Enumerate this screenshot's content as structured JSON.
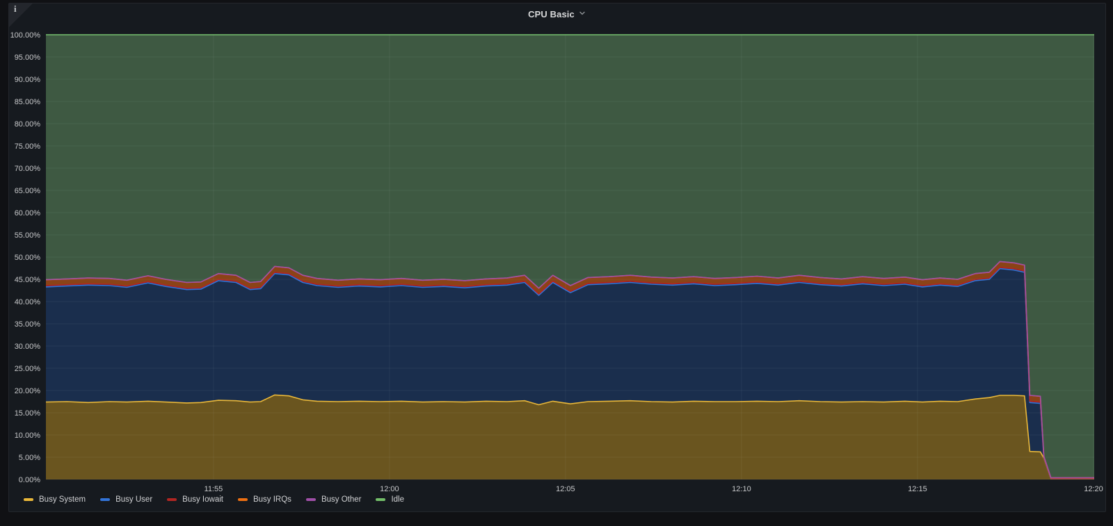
{
  "header": {
    "title": "CPU Basic"
  },
  "corner_icon": {
    "glyph": "i",
    "name": "panel-info"
  },
  "legend": {
    "items": [
      {
        "label": "Busy System",
        "color": "#EAB839"
      },
      {
        "label": "Busy User",
        "color": "#3274D9"
      },
      {
        "label": "Busy Iowait",
        "color": "#B22622"
      },
      {
        "label": "Busy IRQs",
        "color": "#EE7012"
      },
      {
        "label": "Busy Other",
        "color": "#A04FA8"
      },
      {
        "label": "Idle",
        "color": "#73BF69"
      }
    ]
  },
  "chart_data": {
    "type": "area",
    "stacked": true,
    "title": "CPU Basic",
    "x_domain": [
      0,
      29.78
    ],
    "x_axis": {
      "tick_labels": [
        "11:55",
        "12:00",
        "12:05",
        "12:10",
        "12:15",
        "12:20"
      ],
      "tick_positions": [
        4.76,
        9.76,
        14.76,
        19.76,
        24.76,
        29.76
      ]
    },
    "y_axis": {
      "min": 0,
      "max": 100,
      "tick_step": 5,
      "unit": "%",
      "tick_labels": [
        "0.00%",
        "5.00%",
        "10.00%",
        "15.00%",
        "20.00%",
        "25.00%",
        "30.00%",
        "35.00%",
        "40.00%",
        "45.00%",
        "50.00%",
        "55.00%",
        "60.00%",
        "65.00%",
        "70.00%",
        "75.00%",
        "80.00%",
        "85.00%",
        "90.00%",
        "95.00%",
        "100.00%"
      ]
    },
    "grid": true,
    "legend_position": "bottom-left",
    "t_minutes": [
      0,
      0.6,
      1.2,
      1.8,
      2.3,
      2.9,
      3.4,
      4.0,
      4.4,
      4.9,
      5.4,
      5.8,
      6.1,
      6.5,
      6.9,
      7.3,
      7.7,
      8.3,
      8.9,
      9.5,
      10.1,
      10.7,
      11.3,
      11.9,
      12.5,
      13.1,
      13.6,
      14.0,
      14.4,
      14.9,
      15.4,
      16.0,
      16.6,
      17.2,
      17.8,
      18.4,
      19.0,
      19.6,
      20.2,
      20.8,
      21.4,
      22.0,
      22.6,
      23.2,
      23.8,
      24.4,
      24.9,
      25.4,
      25.9,
      26.4,
      26.8,
      27.1,
      27.5,
      27.8,
      27.95,
      28.25,
      28.35,
      28.55,
      29.0,
      29.78
    ],
    "series": [
      {
        "name": "Busy System",
        "color": "#EAB839",
        "fill": "#6a551f",
        "values": [
          17.4,
          17.5,
          17.3,
          17.5,
          17.4,
          17.6,
          17.4,
          17.2,
          17.3,
          17.8,
          17.7,
          17.4,
          17.5,
          19.0,
          18.8,
          17.9,
          17.6,
          17.5,
          17.6,
          17.5,
          17.6,
          17.4,
          17.5,
          17.4,
          17.6,
          17.5,
          17.7,
          16.8,
          17.6,
          17.0,
          17.5,
          17.6,
          17.7,
          17.5,
          17.4,
          17.6,
          17.5,
          17.5,
          17.6,
          17.5,
          17.7,
          17.5,
          17.4,
          17.5,
          17.4,
          17.6,
          17.4,
          17.6,
          17.5,
          18.1,
          18.4,
          18.9,
          18.9,
          18.8,
          6.3,
          6.2,
          4.8,
          0.15,
          0.15,
          0.15
        ]
      },
      {
        "name": "Busy User",
        "color": "#3274D9",
        "fill": "#1a2e4d",
        "values": [
          25.9,
          26.0,
          26.4,
          26.1,
          25.8,
          26.6,
          26.0,
          25.5,
          25.5,
          26.9,
          26.6,
          25.3,
          25.4,
          27.3,
          27.2,
          26.4,
          26.0,
          25.7,
          25.9,
          25.8,
          26.0,
          25.8,
          25.9,
          25.7,
          25.9,
          26.2,
          26.6,
          24.6,
          26.7,
          25.0,
          26.3,
          26.4,
          26.6,
          26.4,
          26.3,
          26.4,
          26.1,
          26.3,
          26.5,
          26.2,
          26.6,
          26.3,
          26.1,
          26.5,
          26.2,
          26.3,
          25.9,
          26.1,
          25.9,
          26.6,
          26.6,
          28.5,
          28.2,
          27.8,
          11.0,
          10.9,
          0.1,
          0.05,
          0.05,
          0.05
        ]
      },
      {
        "name": "Busy Iowait",
        "color": "#B22622",
        "fill": "#4a1d1f",
        "values": [
          0.3,
          0.3,
          0.3,
          0.3,
          0.3,
          0.3,
          0.3,
          0.3,
          0.3,
          0.3,
          0.3,
          0.3,
          0.3,
          0.3,
          0.3,
          0.3,
          0.3,
          0.3,
          0.3,
          0.3,
          0.3,
          0.3,
          0.3,
          0.3,
          0.3,
          0.3,
          0.3,
          0.3,
          0.3,
          0.3,
          0.3,
          0.3,
          0.3,
          0.3,
          0.3,
          0.3,
          0.3,
          0.3,
          0.3,
          0.3,
          0.3,
          0.3,
          0.3,
          0.3,
          0.3,
          0.3,
          0.3,
          0.3,
          0.3,
          0.3,
          0.3,
          0.3,
          0.3,
          0.3,
          0.3,
          0.3,
          0.05,
          0.02,
          0.02,
          0.02
        ]
      },
      {
        "name": "Busy IRQs",
        "color": "#D9661B",
        "fill": "#8a4317",
        "values": [
          1.3,
          1.3,
          1.3,
          1.3,
          1.3,
          1.3,
          1.3,
          1.3,
          1.3,
          1.3,
          1.3,
          1.3,
          1.3,
          1.3,
          1.3,
          1.3,
          1.3,
          1.3,
          1.3,
          1.3,
          1.3,
          1.3,
          1.3,
          1.3,
          1.3,
          1.3,
          1.3,
          1.3,
          1.3,
          1.3,
          1.3,
          1.3,
          1.3,
          1.3,
          1.3,
          1.3,
          1.3,
          1.3,
          1.3,
          1.3,
          1.3,
          1.3,
          1.3,
          1.3,
          1.3,
          1.3,
          1.3,
          1.3,
          1.3,
          1.3,
          1.3,
          1.3,
          1.3,
          1.3,
          1.3,
          1.3,
          0.25,
          0.15,
          0.15,
          0.15
        ]
      },
      {
        "name": "Busy Other",
        "color": "#A04FA8",
        "fill": "#3d2542",
        "values": [
          0,
          0,
          0,
          0,
          0,
          0,
          0,
          0,
          0,
          0,
          0,
          0,
          0,
          0,
          0,
          0,
          0,
          0,
          0,
          0,
          0,
          0,
          0,
          0,
          0,
          0,
          0,
          0,
          0,
          0,
          0,
          0,
          0,
          0,
          0,
          0,
          0,
          0,
          0,
          0,
          0,
          0,
          0,
          0,
          0,
          0,
          0,
          0,
          0,
          0,
          0,
          0,
          0,
          0,
          0,
          0,
          0,
          0,
          0,
          0
        ]
      },
      {
        "name": "Idle",
        "color": "#73BF69",
        "fill": "#3e5942",
        "values": [
          55.1,
          54.9,
          54.7,
          54.8,
          55.2,
          54.2,
          55.0,
          55.7,
          55.6,
          53.7,
          54.1,
          55.7,
          55.5,
          52.1,
          52.4,
          54.1,
          54.8,
          55.2,
          54.9,
          55.1,
          54.8,
          55.2,
          55.0,
          55.3,
          54.9,
          54.7,
          54.1,
          57.0,
          54.1,
          56.4,
          54.6,
          54.4,
          54.1,
          54.5,
          54.7,
          54.4,
          54.8,
          54.6,
          54.3,
          54.7,
          54.1,
          54.6,
          54.9,
          54.4,
          54.8,
          54.5,
          55.1,
          54.7,
          55.0,
          53.7,
          53.4,
          51.0,
          51.3,
          51.8,
          81.1,
          81.3,
          94.8,
          99.63,
          99.63,
          99.63
        ]
      }
    ]
  }
}
